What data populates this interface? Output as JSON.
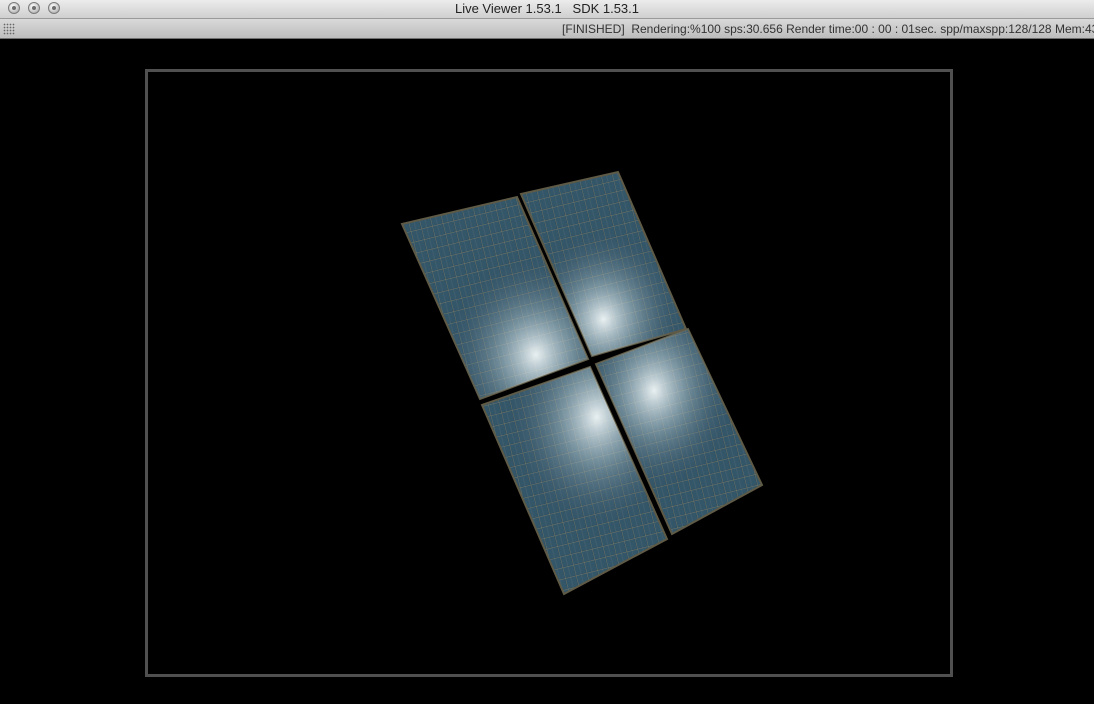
{
  "window": {
    "title": "Live Viewer 1.53.1   SDK 1.53.1",
    "buttons": [
      "close-button",
      "minimize-button",
      "zoom-button"
    ]
  },
  "status": {
    "text": "[FINISHED]  Rendering:%100 sps:30.656 Render time:00 : 00 : 01sec. spp/maxspp:128/128 Mem:43"
  },
  "render": {
    "subject": "solar panels",
    "panel_count": 4,
    "colors": {
      "panel_base": "#2c4a5e",
      "panel_glow": "#e8f2f4",
      "frame_border": "#505050",
      "background": "#000000"
    }
  }
}
